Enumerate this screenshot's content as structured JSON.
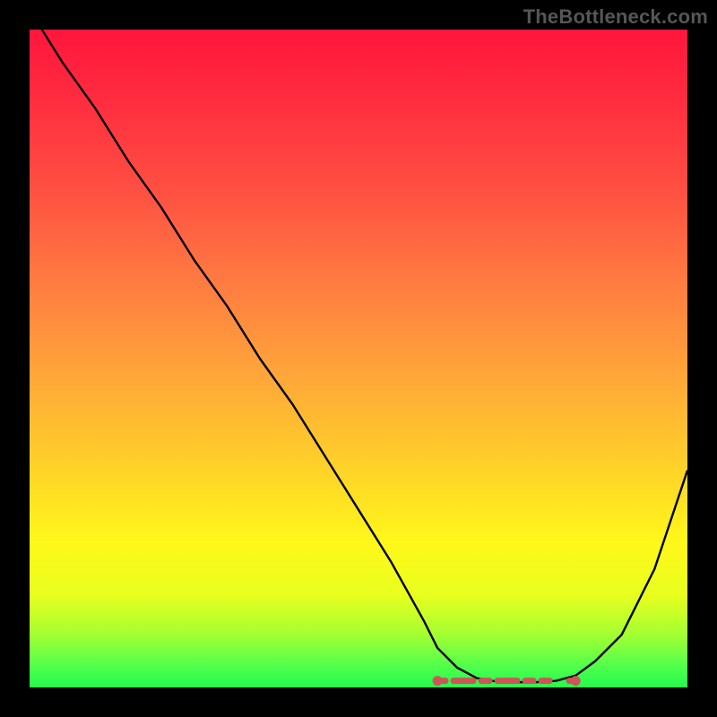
{
  "watermark": "TheBottleneck.com",
  "colors": {
    "frame": "#000000",
    "watermark": "#565656",
    "curve": "#000000",
    "marker": "#cd5558",
    "gradient_stops": [
      "#ff163c",
      "#ff2b3f",
      "#ff5142",
      "#ff7a41",
      "#ffa43a",
      "#ffd029",
      "#fff81a",
      "#e8ff1e",
      "#a3ff32",
      "#4dff4d",
      "#23fa4e"
    ]
  },
  "chart_data": {
    "type": "line",
    "title": "",
    "xlabel": "",
    "ylabel": "",
    "xlim": [
      0,
      100
    ],
    "ylim": [
      0,
      100
    ],
    "x": [
      0,
      5,
      10,
      15,
      20,
      25,
      30,
      35,
      40,
      45,
      50,
      55,
      60,
      62,
      65,
      68,
      71,
      74,
      77,
      80,
      83,
      86,
      90,
      95,
      100
    ],
    "values": [
      103,
      95,
      88,
      80,
      73,
      65,
      58,
      50,
      43,
      35,
      27,
      19,
      10,
      6,
      3,
      1.4,
      0.9,
      0.8,
      0.8,
      1.0,
      1.8,
      4,
      8,
      18,
      33
    ],
    "marker_region": {
      "x_start": 62,
      "x_end": 83,
      "y": 1.0
    },
    "grid": false,
    "legend": false
  }
}
